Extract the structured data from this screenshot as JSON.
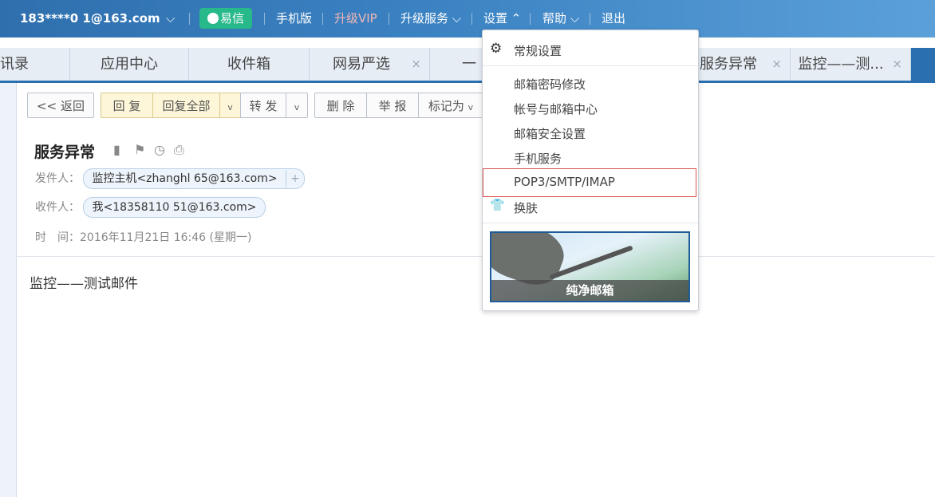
{
  "topbar": {
    "account": "183****0  1@163.com",
    "account_caret": "⌵",
    "yixin": "易信",
    "mobile": "手机版",
    "vip": "升级VIP",
    "upgrade": "升级服务 ⌵",
    "settings": "设置 ⌃",
    "help": "帮助 ⌵",
    "logout": "退出"
  },
  "tabs": [
    {
      "label": "讯录"
    },
    {
      "label": "应用中心"
    },
    {
      "label": "收件箱"
    },
    {
      "label": "网易严选",
      "close": "×"
    },
    {
      "label": "一"
    },
    {
      "label": "服务异常",
      "close": "×"
    },
    {
      "label": "监控——测...",
      "close": "×"
    }
  ],
  "toolbar": {
    "back": "<< 返回",
    "reply": "回 复",
    "reply_all": "回复全部",
    "forward": "转 发",
    "delete": "删 除",
    "report": "举 报",
    "mark_as": "标记为",
    "caret": "v"
  },
  "email": {
    "subject": "服务异常",
    "from_label": "发件人：",
    "from_value": "监控主机<zhanghl   65@163.com>",
    "to_label": "收件人：",
    "to_value": "我<18358110   51@163.com>",
    "time_label": "时　间：",
    "time_value": "2016年11月21日 16:46 (星期一)",
    "body": "监控——测试邮件",
    "plus": "+"
  },
  "settings_menu": {
    "general": "常规设置",
    "password": "邮箱密码修改",
    "account_center": "帐号与邮箱中心",
    "security": "邮箱安全设置",
    "mobile_service": "手机服务",
    "pop3": "POP3/SMTP/IMAP",
    "skin": "换肤",
    "skin_name": "纯净邮箱"
  },
  "icons": {
    "gear": "⚙",
    "shirt": "👕",
    "bookmark": "▮",
    "flag": "⚑",
    "clock": "◷",
    "print": "⎙"
  },
  "colors": {
    "topbar": "#3b82c2",
    "accent": "#2a6fb0",
    "yixin": "#27b98a",
    "highlight_border": "#d9534f"
  }
}
